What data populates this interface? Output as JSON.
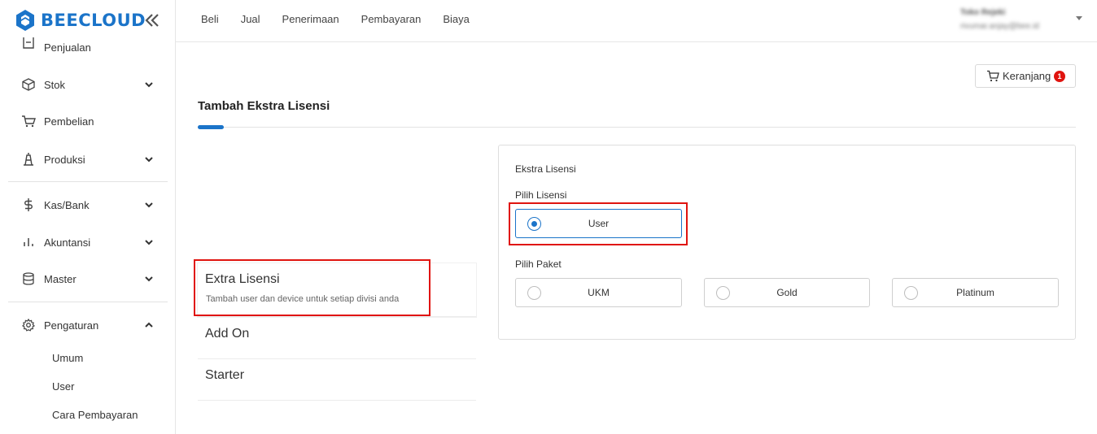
{
  "brand": {
    "name": "BEECLOUD",
    "color": "#1b74c9"
  },
  "sidebar": {
    "items": [
      {
        "label": "Penjualan",
        "icon": "receipt-icon"
      },
      {
        "label": "Stok",
        "icon": "box-icon"
      },
      {
        "label": "Pembelian",
        "icon": "cart-icon"
      },
      {
        "label": "Produksi",
        "icon": "factory-icon"
      },
      {
        "label": "Kas/Bank",
        "icon": "dollar-icon"
      },
      {
        "label": "Akuntansi",
        "icon": "bar-chart-icon"
      },
      {
        "label": "Master",
        "icon": "database-icon"
      },
      {
        "label": "Pengaturan",
        "icon": "gear-icon"
      }
    ],
    "subitems": [
      "Umum",
      "User",
      "Cara Pembayaran"
    ]
  },
  "topnav": [
    "Beli",
    "Jual",
    "Penerimaan",
    "Pembayaran",
    "Biaya"
  ],
  "user": {
    "name": "Toko Rejeki",
    "email": "rivumar.anjay@bee.id"
  },
  "cart": {
    "label": "Keranjang",
    "count": "1"
  },
  "page": {
    "title": "Tambah Ekstra Lisensi"
  },
  "options": [
    {
      "title": "Extra Lisensi",
      "desc": "Tambah user dan device untuk setiap divisi anda"
    },
    {
      "title": "Add On",
      "desc": ""
    },
    {
      "title": "Starter",
      "desc": ""
    }
  ],
  "panel": {
    "title": "Ekstra Lisensi",
    "license_label": "Pilih Lisensi",
    "license_options": [
      {
        "label": "User",
        "selected": true
      }
    ],
    "package_label": "Pilih Paket",
    "package_options": [
      {
        "label": "UKM",
        "selected": false
      },
      {
        "label": "Gold",
        "selected": false
      },
      {
        "label": "Platinum",
        "selected": false
      }
    ]
  },
  "colors": {
    "accent": "#1b74c9",
    "highlight": "#e0140f",
    "badge": "#e0140f"
  }
}
